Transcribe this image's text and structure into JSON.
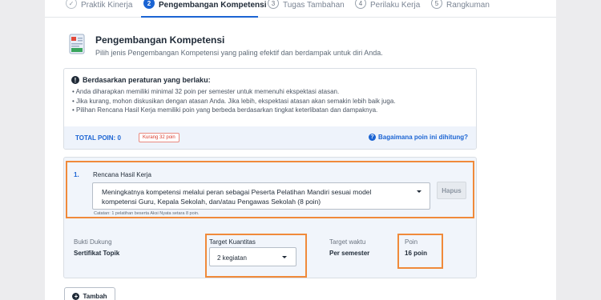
{
  "stepper": {
    "steps": [
      {
        "num": "✓",
        "label": "Praktik Kinerja",
        "state": "done"
      },
      {
        "num": "2",
        "label": "Pengembangan Kompetensi",
        "state": "active"
      },
      {
        "num": "3",
        "label": "Tugas Tambahan",
        "state": "pending"
      },
      {
        "num": "4",
        "label": "Perilaku Kerja",
        "state": "pending"
      },
      {
        "num": "5",
        "label": "Rangkuman",
        "state": "pending"
      }
    ]
  },
  "section": {
    "icon": "document-icon",
    "title": "Pengembangan Kompetensi",
    "subtitle": "Pilih jenis Pengembangan Kompetensi yang paling efektif dan berdampak untuk diri Anda."
  },
  "info": {
    "heading": "Berdasarkan peraturan yang berlaku:",
    "items": [
      "Anda diharapkan memiliki minimal 32 poin per semester untuk memenuhi ekspektasi atasan.",
      "Jika kurang, mohon diskusikan dengan atasan Anda. Jika lebih, ekspektasi atasan akan semakin lebih baik juga.",
      "Pilihan Rencana Hasil Kerja memiliki poin yang berbeda berdasarkan tingkat keterlibatan dan dampaknya."
    ],
    "total_label": "TOTAL POIN: 0",
    "badge": "Kurang 32 poin",
    "help_link": "Bagaimana poin ini dihitung?"
  },
  "plan": {
    "number": "1.",
    "label": "Rencana Hasil Kerja",
    "selected_line1": "Meningkatnya kompetensi melalui peran sebagai Peserta Pelatihan Mandiri sesuai model",
    "selected_line2": "kompetensi Guru, Kepala Sekolah, dan/atau Pengawas Sekolah (8 poin)",
    "delete_button": "Hapus",
    "note": "Catatan: 1 pelatihan beserta Aksi Nyata setara 8 poin.",
    "bukti_label": "Bukti Dukung",
    "bukti_value": "Sertifikat Topik",
    "target_label": "Target Kuantitas",
    "target_value": "2 kegiatan",
    "waktu_label": "Target waktu",
    "waktu_value": "Per semester",
    "poin_label": "Poin",
    "poin_value": "16 poin"
  },
  "add_button": "Tambah",
  "colors": {
    "primary": "#1b64d3",
    "highlight": "#f08a3a",
    "danger": "#d93a2b"
  }
}
